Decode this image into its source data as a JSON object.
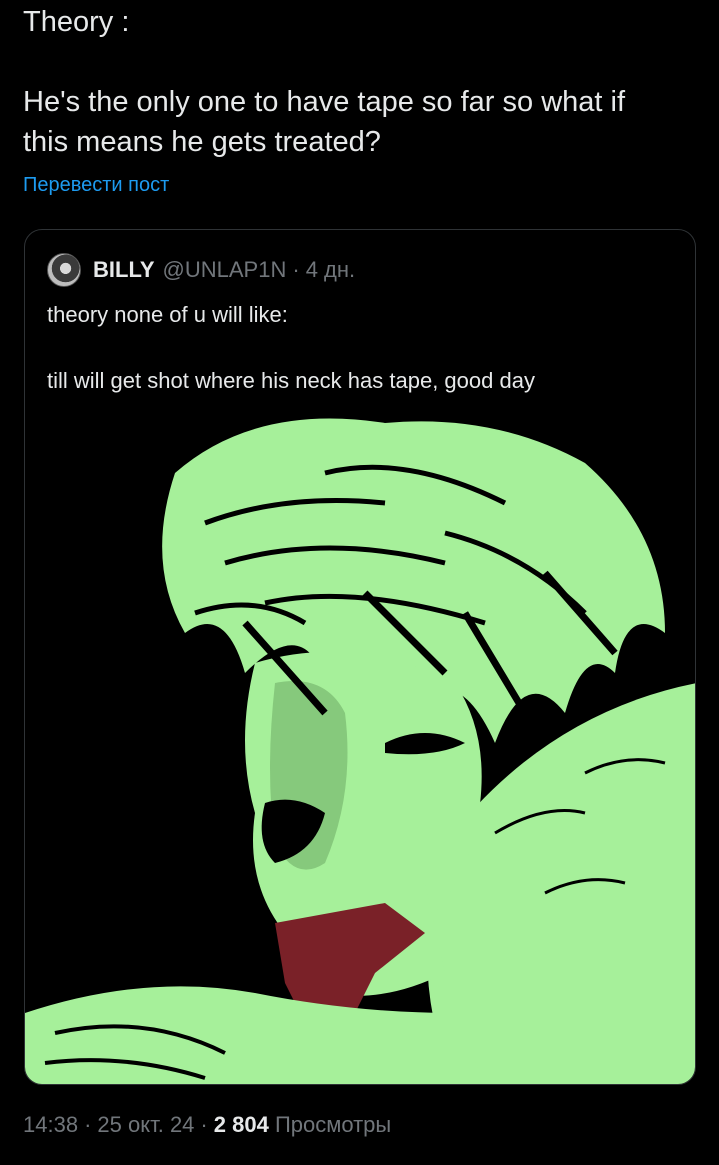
{
  "post": {
    "text_line_1": "Theory :",
    "text_line_2": "He's the only one to have tape so far so what if",
    "text_line_3": "this means he gets treated?",
    "translate_label": "Перевести пост"
  },
  "quote": {
    "author_name": "BILLY",
    "author_handle": "@UNLAP1N",
    "separator": "·",
    "age": "4 дн.",
    "text_line_1": "theory none of u will like:",
    "text_line_2": "till will get shot where his neck has tape, good day",
    "media_icon": "artwork-image",
    "colors": {
      "skin": "#a6f09a",
      "shade": "#86c97c",
      "tie": "#7a2128",
      "ink": "#000000"
    }
  },
  "meta": {
    "time": "14:38",
    "dot": "·",
    "date": "25 окт. 24",
    "views_count": "2 804",
    "views_label": "Просмотры"
  },
  "colors": {
    "background": "#000000",
    "text": "#e7e9ea",
    "muted": "#71767b",
    "link": "#1d9bf0",
    "border": "#2f3336"
  }
}
